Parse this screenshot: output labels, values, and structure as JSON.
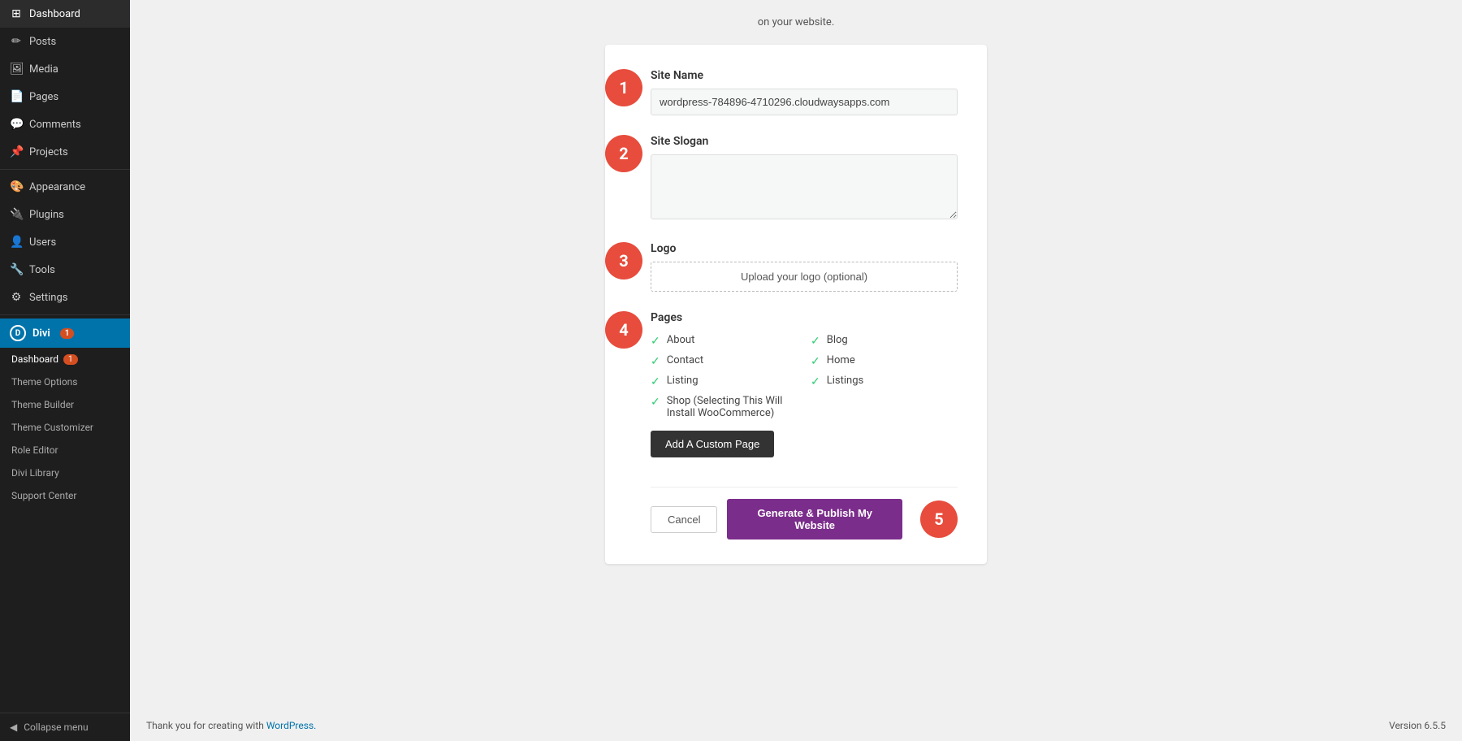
{
  "sidebar": {
    "items": [
      {
        "label": "Dashboard",
        "icon": "⊞"
      },
      {
        "label": "Posts",
        "icon": "✎"
      },
      {
        "label": "Media",
        "icon": "🖼"
      },
      {
        "label": "Pages",
        "icon": "📄"
      },
      {
        "label": "Comments",
        "icon": "💬"
      },
      {
        "label": "Projects",
        "icon": "📁"
      },
      {
        "label": "Appearance",
        "icon": "🎨"
      },
      {
        "label": "Plugins",
        "icon": "🔌"
      },
      {
        "label": "Users",
        "icon": "👤"
      },
      {
        "label": "Tools",
        "icon": "🔧"
      },
      {
        "label": "Settings",
        "icon": "⚙"
      }
    ],
    "divi": {
      "label": "Divi",
      "badge": "1",
      "subitems": [
        {
          "label": "Dashboard",
          "badge": "1"
        },
        {
          "label": "Theme Options"
        },
        {
          "label": "Theme Builder"
        },
        {
          "label": "Theme Customizer"
        },
        {
          "label": "Role Editor"
        },
        {
          "label": "Divi Library"
        },
        {
          "label": "Support Center"
        }
      ]
    },
    "collapse_label": "Collapse menu"
  },
  "top_text": "on your website.",
  "wizard": {
    "steps": [
      {
        "number": "1",
        "label": "Site Name",
        "input_value": "wordpress-784896-4710296.cloudwaysapps.com",
        "input_placeholder": ""
      },
      {
        "number": "2",
        "label": "Site Slogan",
        "textarea_value": "",
        "textarea_placeholder": ""
      },
      {
        "number": "3",
        "label": "Logo",
        "upload_label": "Upload your logo (optional)"
      }
    ],
    "pages_section": {
      "label": "Pages",
      "badge_number": "4",
      "pages_col1": [
        {
          "label": "About",
          "checked": true
        },
        {
          "label": "Contact",
          "checked": true
        },
        {
          "label": "Listing",
          "checked": true
        },
        {
          "label": "Shop (Selecting This Will Install WooCommerce)",
          "checked": true
        }
      ],
      "pages_col2": [
        {
          "label": "Blog",
          "checked": true
        },
        {
          "label": "Home",
          "checked": true
        },
        {
          "label": "Listings",
          "checked": true
        }
      ],
      "add_custom_label": "Add A Custom Page"
    },
    "footer": {
      "cancel_label": "Cancel",
      "publish_label": "Generate & Publish My Website",
      "step5_number": "5"
    }
  },
  "footer": {
    "thanks_text": "Thank you for creating with ",
    "wordpress_link": "WordPress.",
    "version": "Version 6.5.5"
  }
}
